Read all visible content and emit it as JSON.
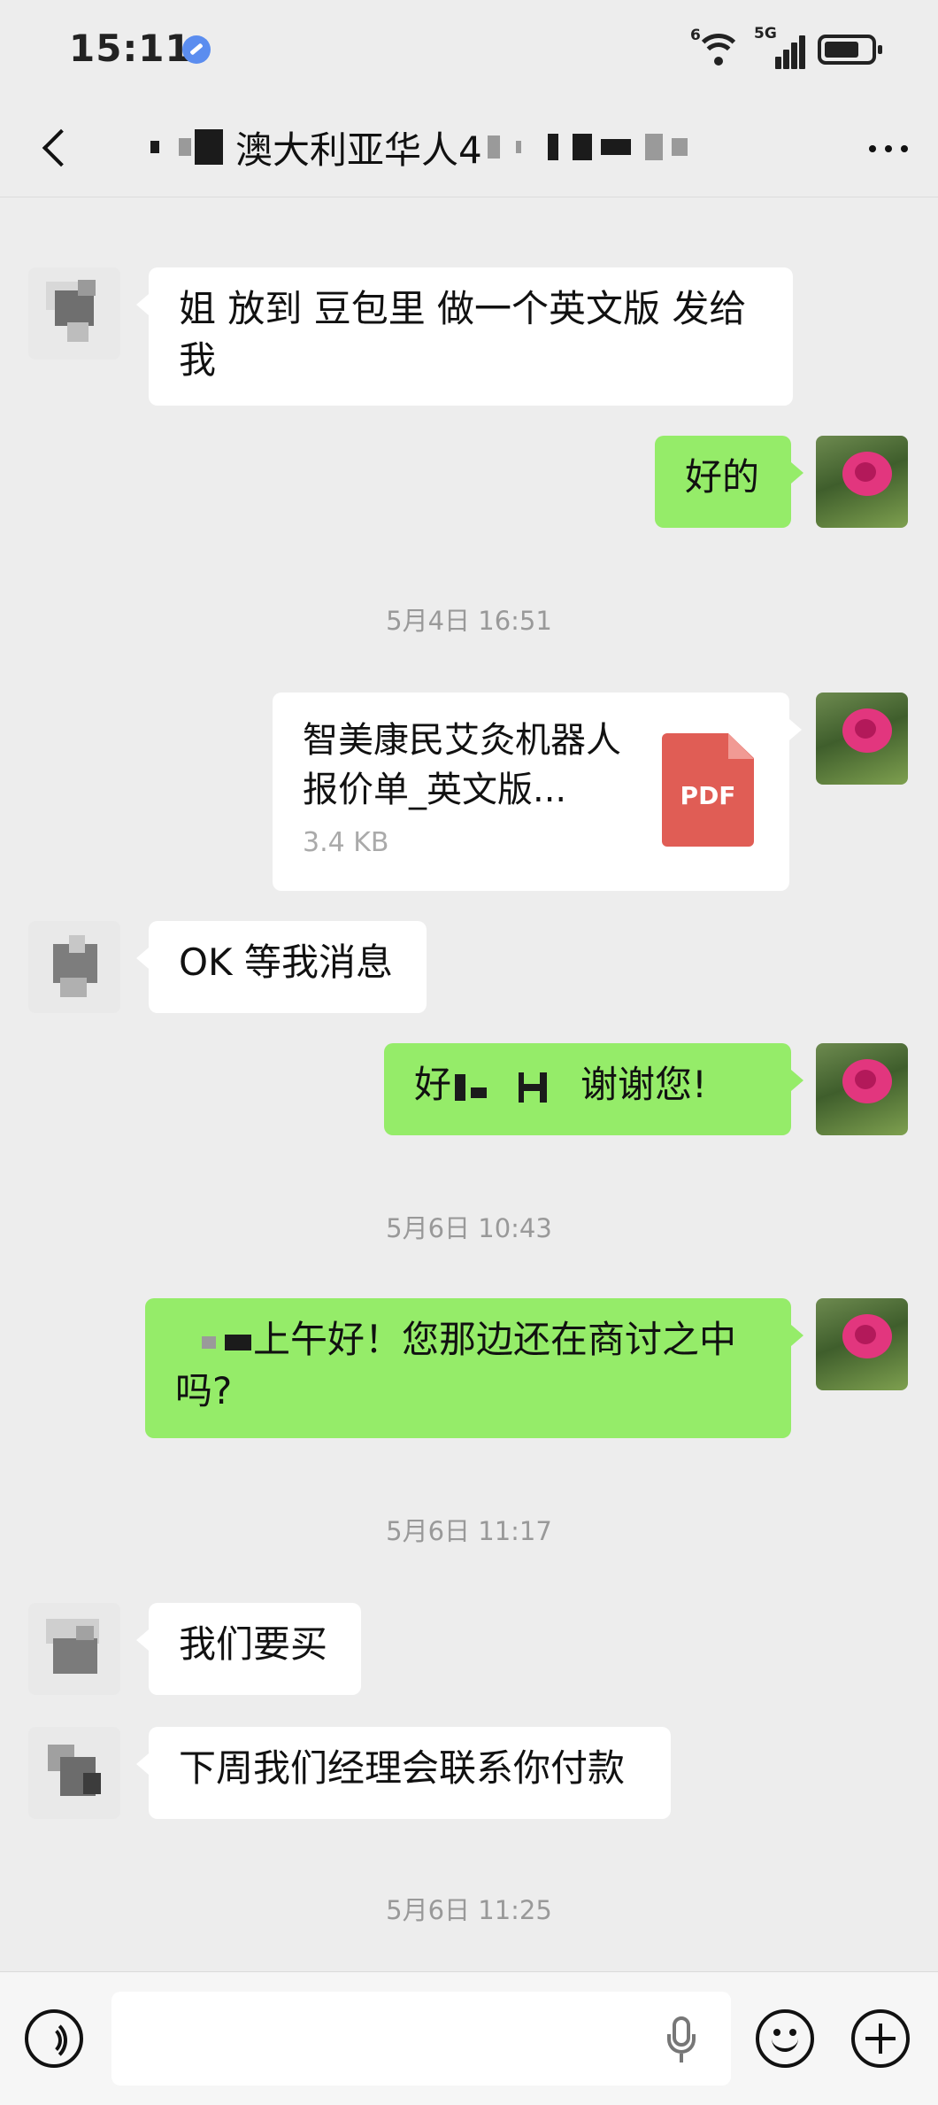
{
  "status_bar": {
    "time": "15:11",
    "wifi_label": "6",
    "network_label": "5G",
    "battery_level": 0.75
  },
  "nav": {
    "title": "澳大利亚华人4",
    "back_icon": "chevron-left-icon",
    "more_icon": "more-dots-icon"
  },
  "messages": [
    {
      "kind": "message",
      "side": "in",
      "text": "姐 放到 豆包里 做一个英文版 发给我"
    },
    {
      "kind": "message",
      "side": "out",
      "text": "好的"
    },
    {
      "kind": "timestamp",
      "text": "5月4日 16:51"
    },
    {
      "kind": "file",
      "side": "out",
      "file_name": "智美康民艾灸机器人报价单_英文版...",
      "file_size": "3.4 KB",
      "file_type": "PDF"
    },
    {
      "kind": "message",
      "side": "in",
      "text": "OK 等我消息"
    },
    {
      "kind": "message",
      "side": "out",
      "text_before": "好",
      "text_after": "谢谢您!"
    },
    {
      "kind": "timestamp",
      "text": "5月6日 10:43"
    },
    {
      "kind": "message",
      "side": "out",
      "text": "上午好！您那边还在商讨之中吗?"
    },
    {
      "kind": "timestamp",
      "text": "5月6日 11:17"
    },
    {
      "kind": "message",
      "side": "in",
      "text": "我们要买"
    },
    {
      "kind": "message",
      "side": "in",
      "text": "下周我们经理会联系你付款"
    },
    {
      "kind": "timestamp",
      "text": "5月6日 11:25"
    }
  ],
  "input_bar": {
    "voice_icon": "voice-icon",
    "mic_icon": "microphone-icon",
    "emoji_icon": "emoji-icon",
    "plus_icon": "plus-icon"
  },
  "colors": {
    "background": "#ededed",
    "incoming_bubble": "#ffffff",
    "outgoing_bubble": "#95ec69",
    "timestamp_text": "#999999",
    "pdf_icon": "#e05d55"
  }
}
